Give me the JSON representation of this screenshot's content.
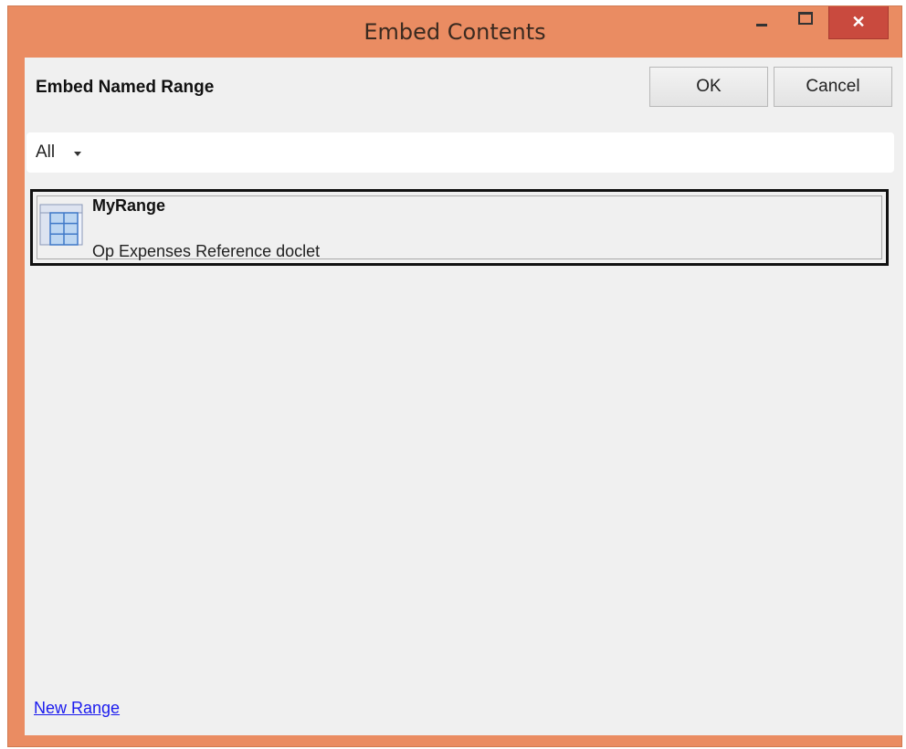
{
  "window": {
    "title": "Embed Contents",
    "controls": {
      "minimize": "minimize-icon",
      "maximize": "maximize-icon",
      "close_label": "✕"
    }
  },
  "header": {
    "title": "Embed Named Range",
    "ok_label": "OK",
    "cancel_label": "Cancel"
  },
  "filter": {
    "selected": "All",
    "icon": "chevron-down-icon"
  },
  "ranges": [
    {
      "name": "MyRange",
      "description": "Op Expenses Reference doclet",
      "icon": "table-grid-icon"
    }
  ],
  "footer": {
    "new_range_label": "New Range"
  },
  "colors": {
    "frame": "#ea8c62",
    "close_button": "#c94a3e",
    "client_bg": "#f0f0f0",
    "link": "#1a1aee"
  }
}
